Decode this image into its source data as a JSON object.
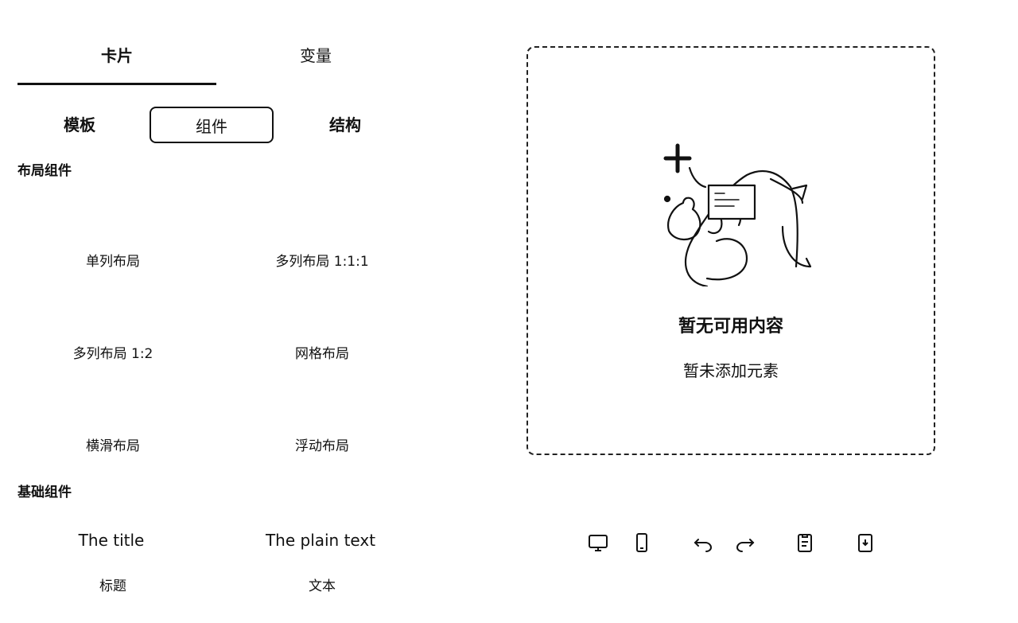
{
  "top_tabs": [
    {
      "label": "卡片",
      "active": true
    },
    {
      "label": "变量",
      "active": false
    }
  ],
  "sub_tabs": [
    {
      "label": "模板",
      "active": false
    },
    {
      "label": "组件",
      "active": true
    },
    {
      "label": "结构",
      "active": false
    }
  ],
  "layout_section": {
    "title": "布局组件",
    "items": [
      "单列布局",
      "多列布局 1:1:1",
      "多列布局 1:2",
      "网格布局",
      "横滑布局",
      "浮动布局"
    ]
  },
  "basic_section": {
    "title": "基础组件",
    "items": [
      {
        "preview": "The title",
        "caption": "标题"
      },
      {
        "preview": "The plain text",
        "caption": "文本"
      }
    ]
  },
  "canvas": {
    "empty_title": "暂无可用内容",
    "empty_desc": "暂未添加元素"
  },
  "toolbar": {
    "icons": [
      "desktop-icon",
      "mobile-icon",
      "undo-icon",
      "redo-icon",
      "clipboard-icon",
      "import-icon"
    ]
  }
}
